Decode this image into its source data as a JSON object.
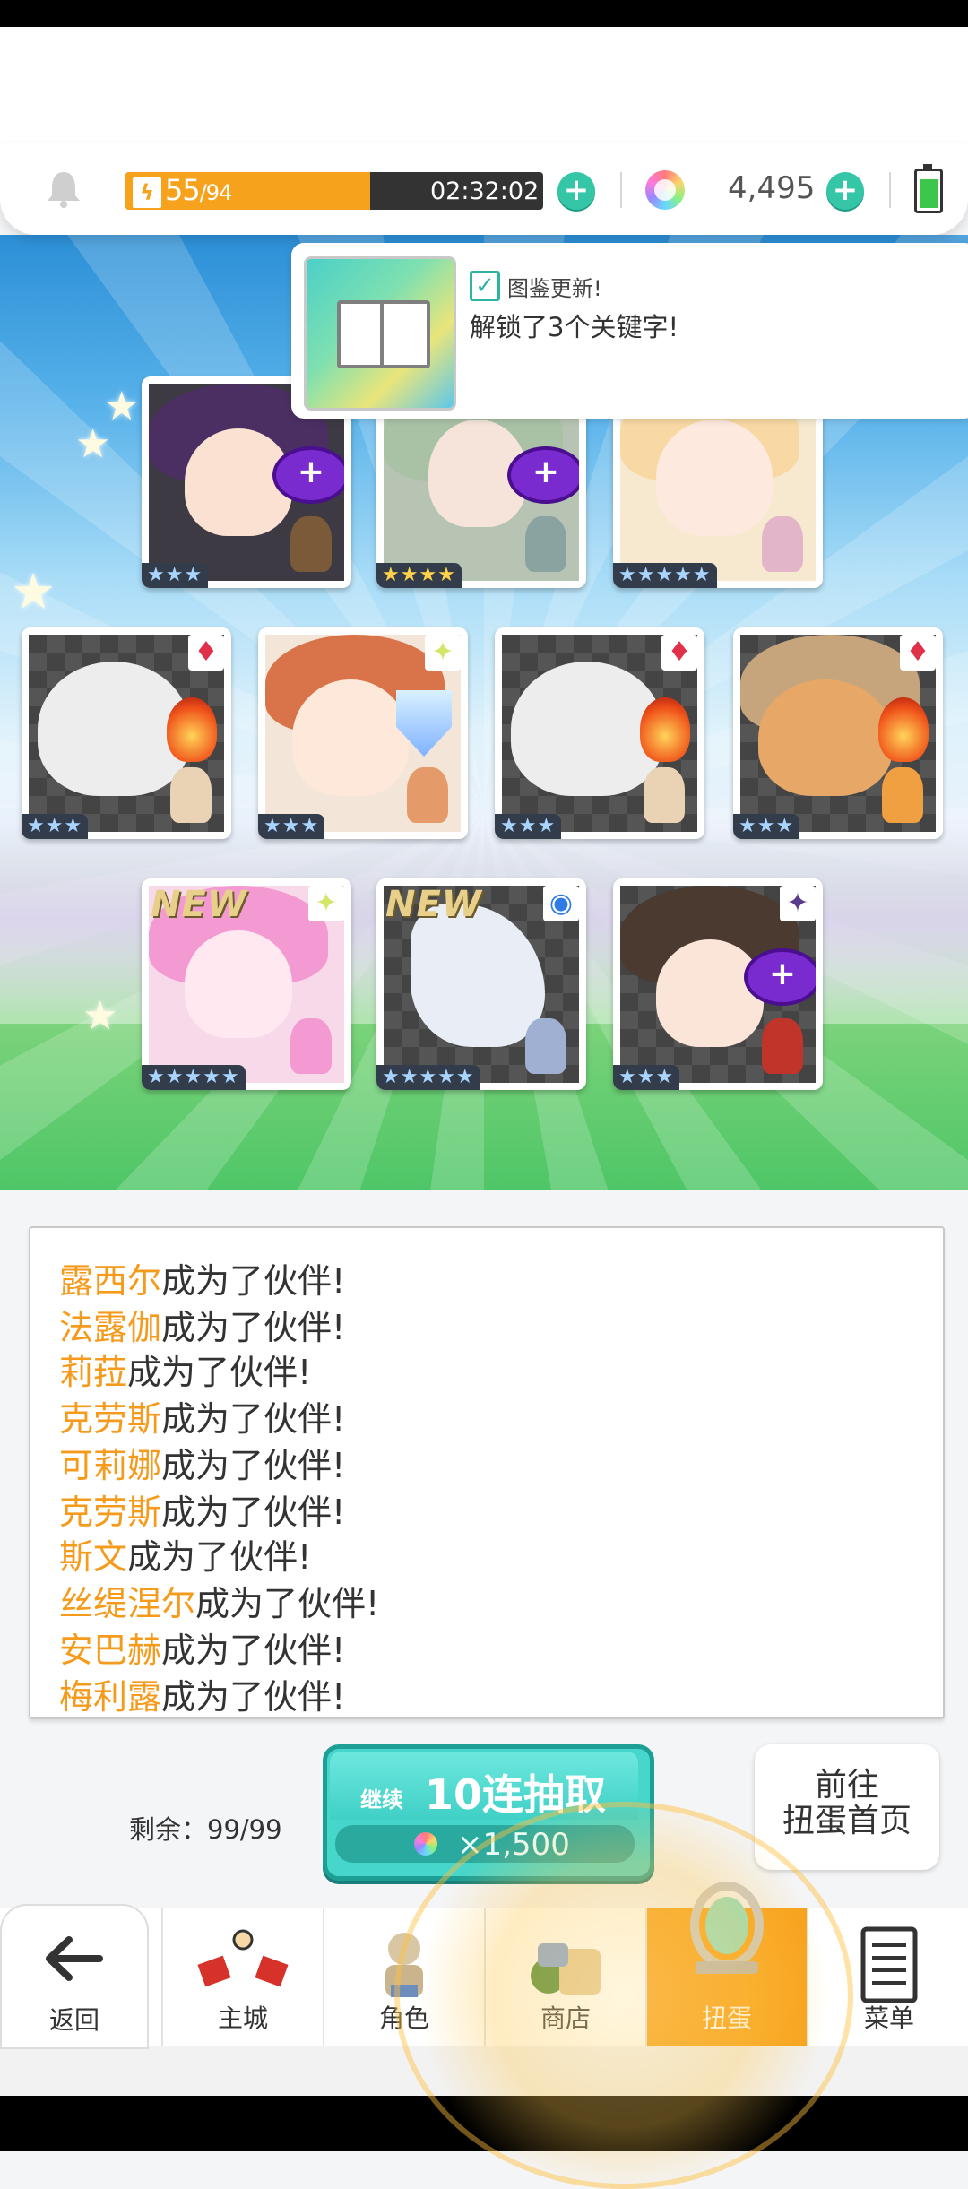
{
  "header": {
    "stamina_current": "55",
    "stamina_max": "/94",
    "stamina_fraction": 0.585,
    "timer": "02:32:02",
    "gems": "4,495"
  },
  "notification": {
    "title": "图鉴更新!",
    "body": "解锁了3个关键字!"
  },
  "cards": [
    {
      "rarity": "★★★"
    },
    {
      "rarity": "★★★★"
    },
    {
      "rarity": "★★★★★"
    },
    {
      "rarity": "★★★"
    },
    {
      "rarity": "★★★"
    },
    {
      "rarity": "★★★"
    },
    {
      "rarity": "★★★"
    },
    {
      "rarity": "★★★★★",
      "tag": "NEW"
    },
    {
      "rarity": "★★★★★",
      "tag": "NEW"
    },
    {
      "rarity": "★★★"
    }
  ],
  "log": {
    "suffix": "成为了伙伴!",
    "names": [
      "露西尔",
      "法露伽",
      "莉菈",
      "克劳斯",
      "可莉娜",
      "克劳斯",
      "斯文",
      "丝缇涅尔",
      "安巴赫",
      "梅利露"
    ]
  },
  "actions": {
    "remaining": "剩余：99/99",
    "continue_label": "继续",
    "draw_label": "10连抽取",
    "draw_cost": "×1,500",
    "goto_line1": "前往",
    "goto_line2": "扭蛋首页"
  },
  "nav": {
    "back": "返回",
    "main_city": "主城",
    "character": "角色",
    "shop": "商店",
    "gacha": "扭蛋",
    "menu": "菜单"
  },
  "colors": {
    "accent_orange": "#f7a21d",
    "teal": "#35c6a8",
    "name_orange": "#f59a1b"
  }
}
